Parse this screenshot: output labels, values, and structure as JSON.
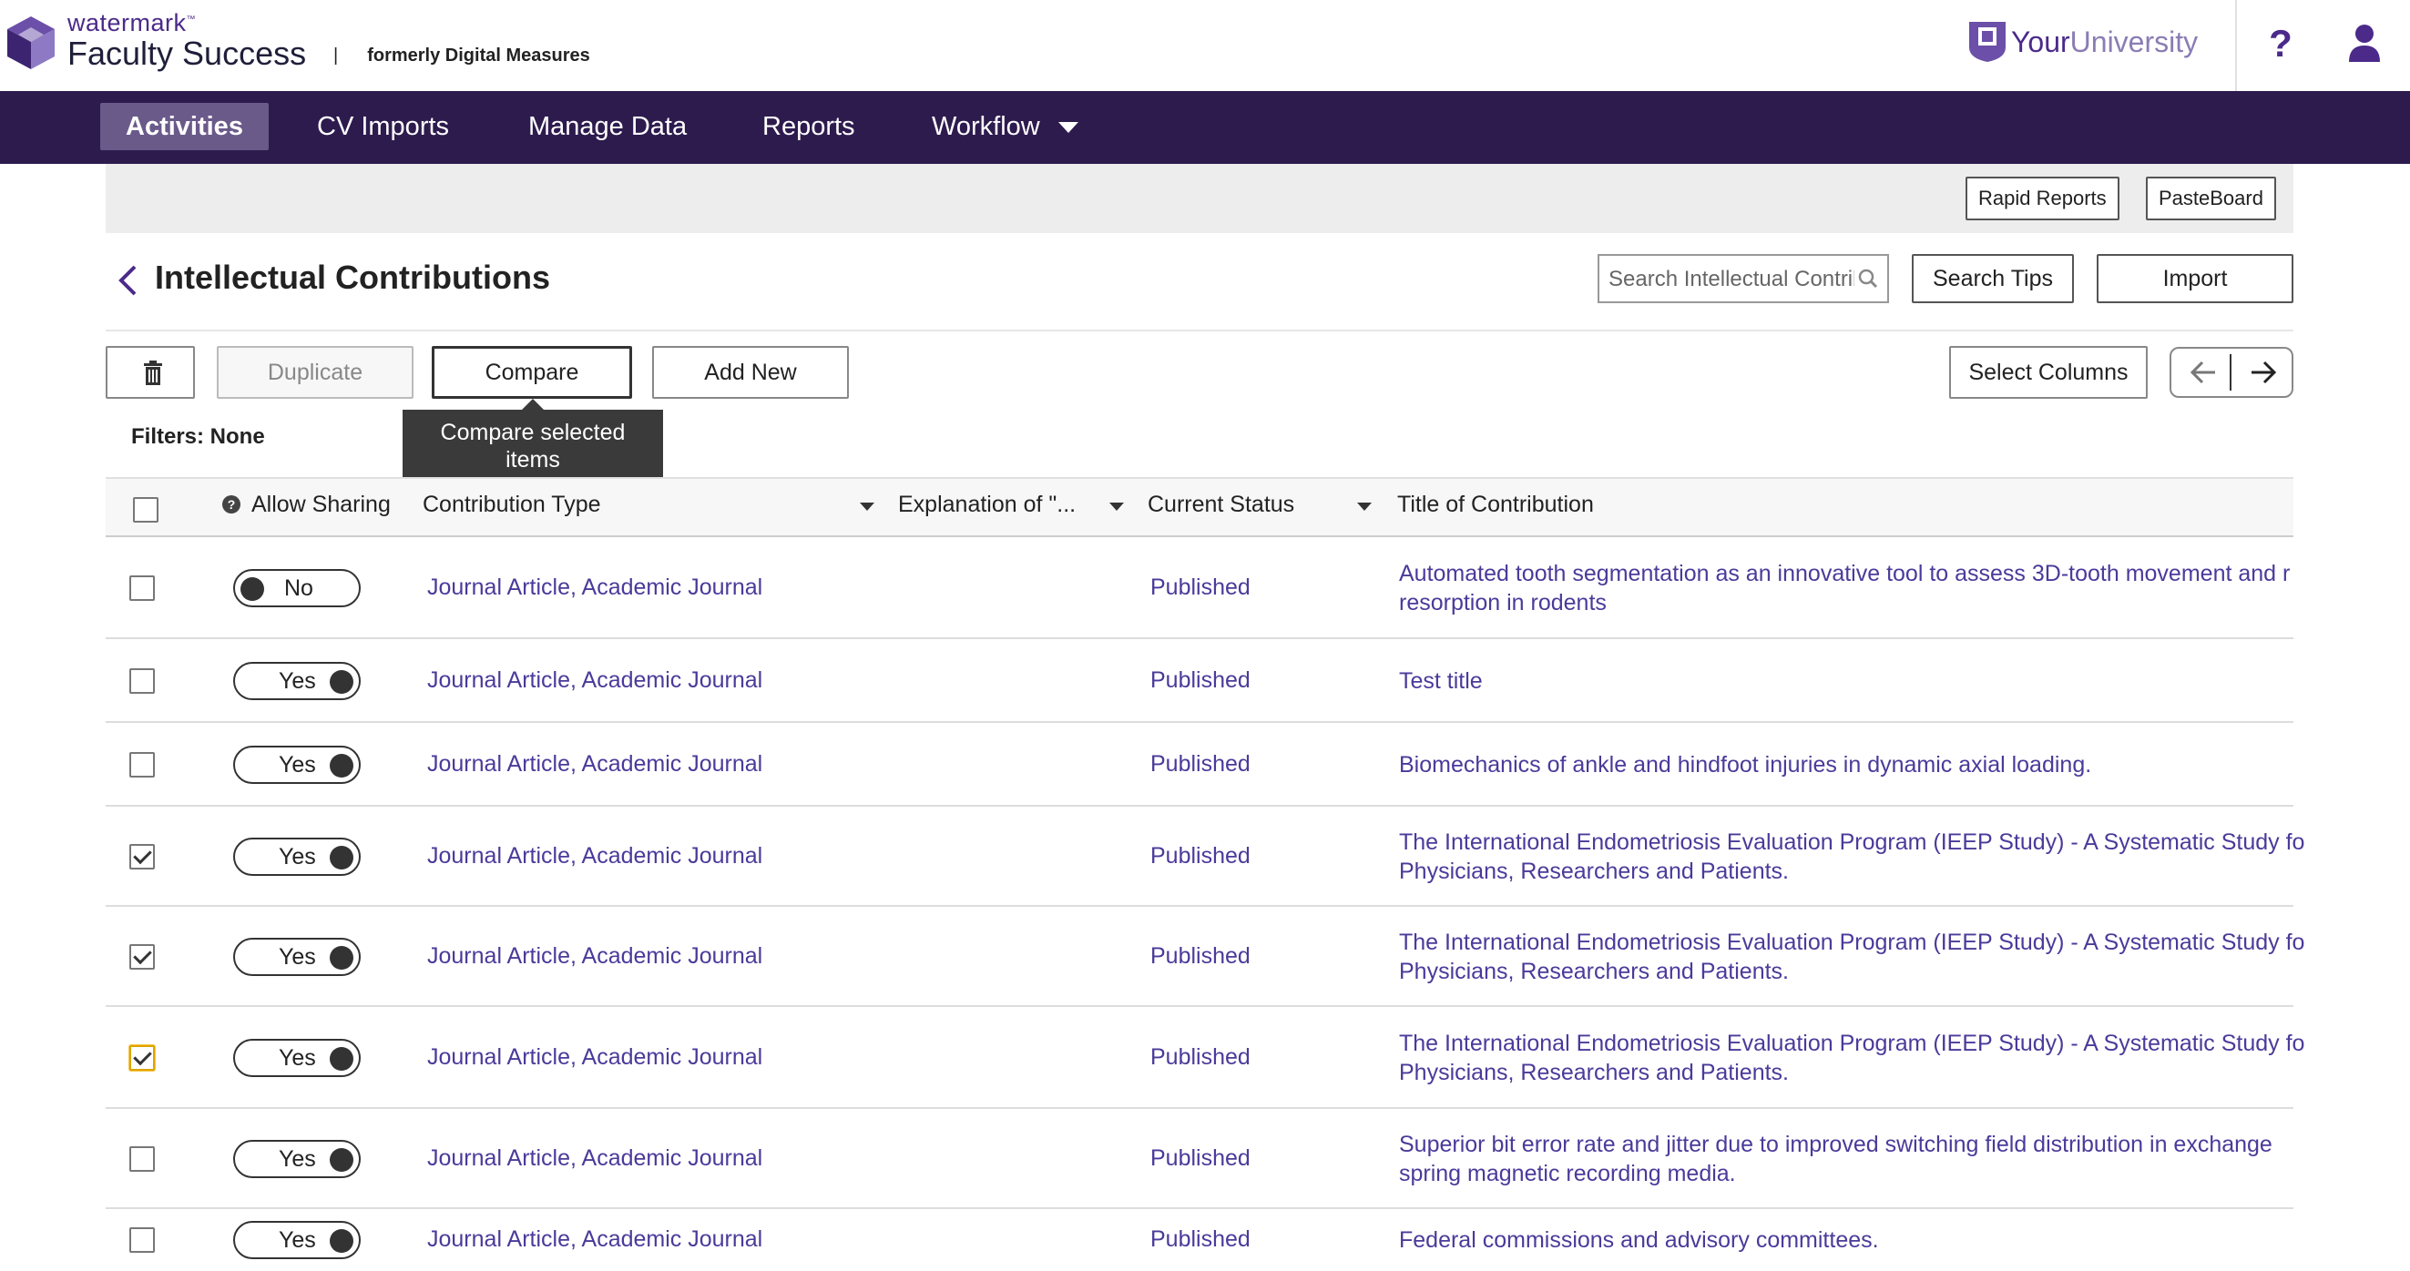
{
  "brand": {
    "small": "watermark",
    "tm": "™",
    "product": "Faculty Success",
    "separator": "|",
    "formerly": "formerly Digital Measures",
    "university_bold": "Your",
    "university_light": "University"
  },
  "header": {
    "help": "?"
  },
  "nav": {
    "items": [
      {
        "label": "Activities",
        "active": true
      },
      {
        "label": "CV Imports"
      },
      {
        "label": "Manage Data"
      },
      {
        "label": "Reports"
      },
      {
        "label": "Workflow"
      }
    ]
  },
  "graybar": {
    "rapid_reports": "Rapid Reports",
    "pasteboard": "PasteBoard"
  },
  "page": {
    "title": "Intellectual Contributions",
    "search_placeholder": "Search Intellectual Contributions",
    "search_tips": "Search Tips",
    "import": "Import"
  },
  "toolbar": {
    "duplicate": "Duplicate",
    "compare": "Compare",
    "add_new": "Add New",
    "select_columns": "Select Columns",
    "tooltip_line1": "Compare selected",
    "tooltip_line2": "items"
  },
  "filters": "Filters: None",
  "table": {
    "info": "?",
    "headers": {
      "allow_sharing": "Allow Sharing",
      "contribution_type": "Contribution Type",
      "explanation": "Explanation of \"...",
      "current_status": "Current Status",
      "title": "Title of Contribution"
    },
    "rows": [
      {
        "checked": false,
        "sharing": "No",
        "type": "Journal Article, Academic Journal",
        "status": "Published",
        "title1": "Automated tooth segmentation as an innovative tool to assess 3D-tooth movement and r",
        "title2": "resorption in rodents"
      },
      {
        "checked": false,
        "sharing": "Yes",
        "type": "Journal Article, Academic Journal",
        "status": "Published",
        "title1": "Test title",
        "title2": ""
      },
      {
        "checked": false,
        "sharing": "Yes",
        "type": "Journal Article, Academic Journal",
        "status": "Published",
        "title1": "Biomechanics of ankle and hindfoot injuries in dynamic axial loading.",
        "title2": ""
      },
      {
        "checked": true,
        "sharing": "Yes",
        "type": "Journal Article, Academic Journal",
        "status": "Published",
        "title1": "The International Endometriosis Evaluation Program (IEEP Study) - A Systematic Study fo",
        "title2": "Physicians, Researchers and Patients."
      },
      {
        "checked": true,
        "sharing": "Yes",
        "type": "Journal Article, Academic Journal",
        "status": "Published",
        "title1": "The International Endometriosis Evaluation Program (IEEP Study) - A Systematic Study fo",
        "title2": "Physicians, Researchers and Patients."
      },
      {
        "checked": true,
        "focused": true,
        "sharing": "Yes",
        "type": "Journal Article, Academic Journal",
        "status": "Published",
        "title1": "The International Endometriosis Evaluation Program (IEEP Study) - A Systematic Study fo",
        "title2": "Physicians, Researchers and Patients."
      },
      {
        "checked": false,
        "sharing": "Yes",
        "type": "Journal Article, Academic Journal",
        "status": "Published",
        "title1": "Superior bit error rate and jitter due to improved switching field distribution in exchange",
        "title2": "spring magnetic recording media."
      },
      {
        "checked": false,
        "sharing": "Yes",
        "type": "Journal Article, Academic Journal",
        "status": "Published",
        "title1": "Federal commissions and advisory committees.",
        "title2": ""
      }
    ]
  },
  "colors": {
    "nav_bg": "#2d1b4e",
    "accent": "#4b2a8a",
    "link": "#4b3a9a",
    "active_tab": "#6a5a8a"
  }
}
